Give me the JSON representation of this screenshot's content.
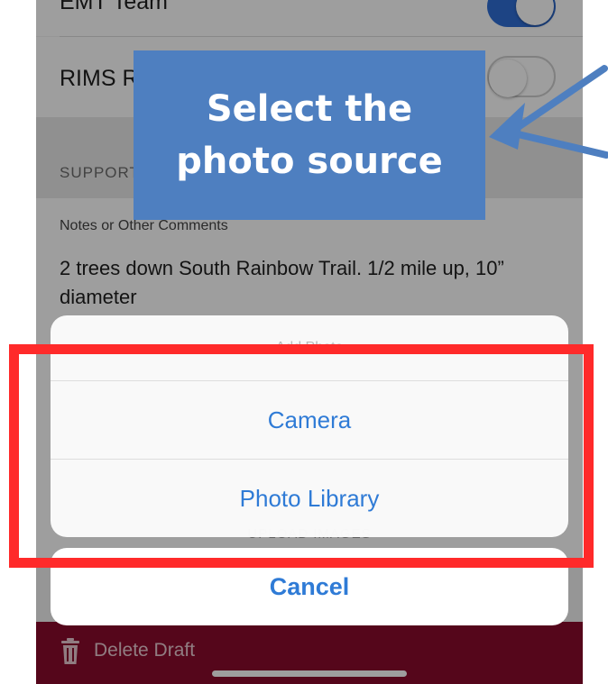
{
  "form": {
    "top_row_label": "EMT Team",
    "rims_row_label": "RIMS Report",
    "section_title": "SUPPORTING INFORMATION",
    "notes_label": "Notes or Other Comments",
    "notes_value": "2 trees down South Rainbow Trail. 1/2 mile up, 10” diameter",
    "upload_label": "UPLOAD IMAGES"
  },
  "toggles": {
    "top_row_on": true,
    "rims_row_on": false
  },
  "action_sheet": {
    "title": "Add Photo",
    "options": [
      "Camera",
      "Photo Library"
    ],
    "cancel_label": "Cancel"
  },
  "bottom_bar": {
    "delete_label": "Delete Draft",
    "icon": "trash-icon"
  },
  "annotation": {
    "callout_text": "Select the photo source",
    "highlight_color": "#ff2a2a",
    "callout_color": "#4e7fc0"
  },
  "colors": {
    "accent": "#2f7bd6",
    "toggle_on": "#2f6ed6",
    "bottom_bar": "#8a0a2c"
  }
}
